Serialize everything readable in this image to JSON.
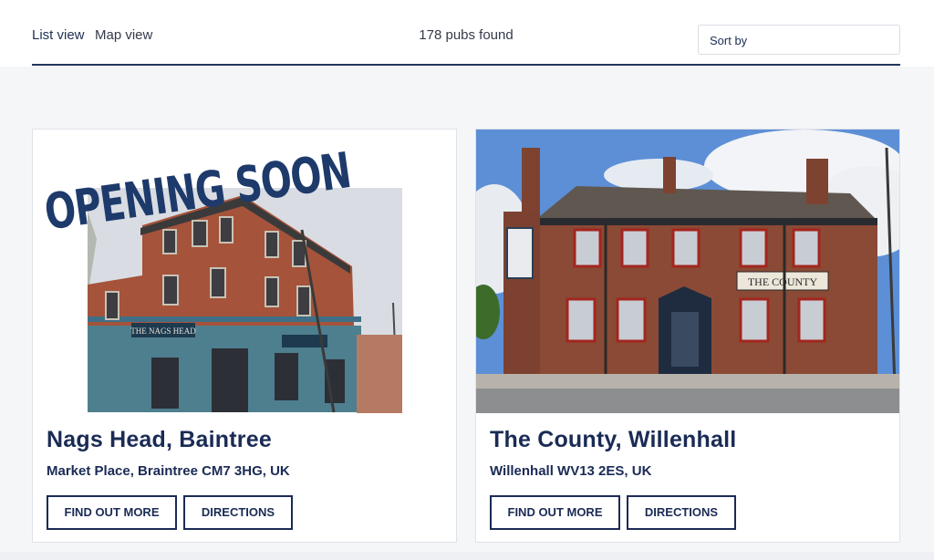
{
  "header": {
    "tabs": [
      {
        "label": "List view"
      },
      {
        "label": "Map view"
      }
    ],
    "results_count": "178 pubs found",
    "sort": {
      "label": "Sort by"
    }
  },
  "pubs": [
    {
      "name": "Nags Head, Baintree",
      "address": "Market Place, Braintree CM7 3HG, UK",
      "banner": "OPENING SOON",
      "sign_text": "THE NAGS HEAD",
      "find_out_more": "FIND OUT MORE",
      "directions": "DIRECTIONS"
    },
    {
      "name": "The County, Willenhall",
      "address": "Willenhall WV13 2ES, UK",
      "sign_text": "THE COUNTY",
      "find_out_more": "FIND OUT MORE",
      "directions": "DIRECTIONS"
    }
  ],
  "colors": {
    "brand_navy": "#1a2b55",
    "brick": "#9b4a2c",
    "sky": "#5d8fd6"
  }
}
